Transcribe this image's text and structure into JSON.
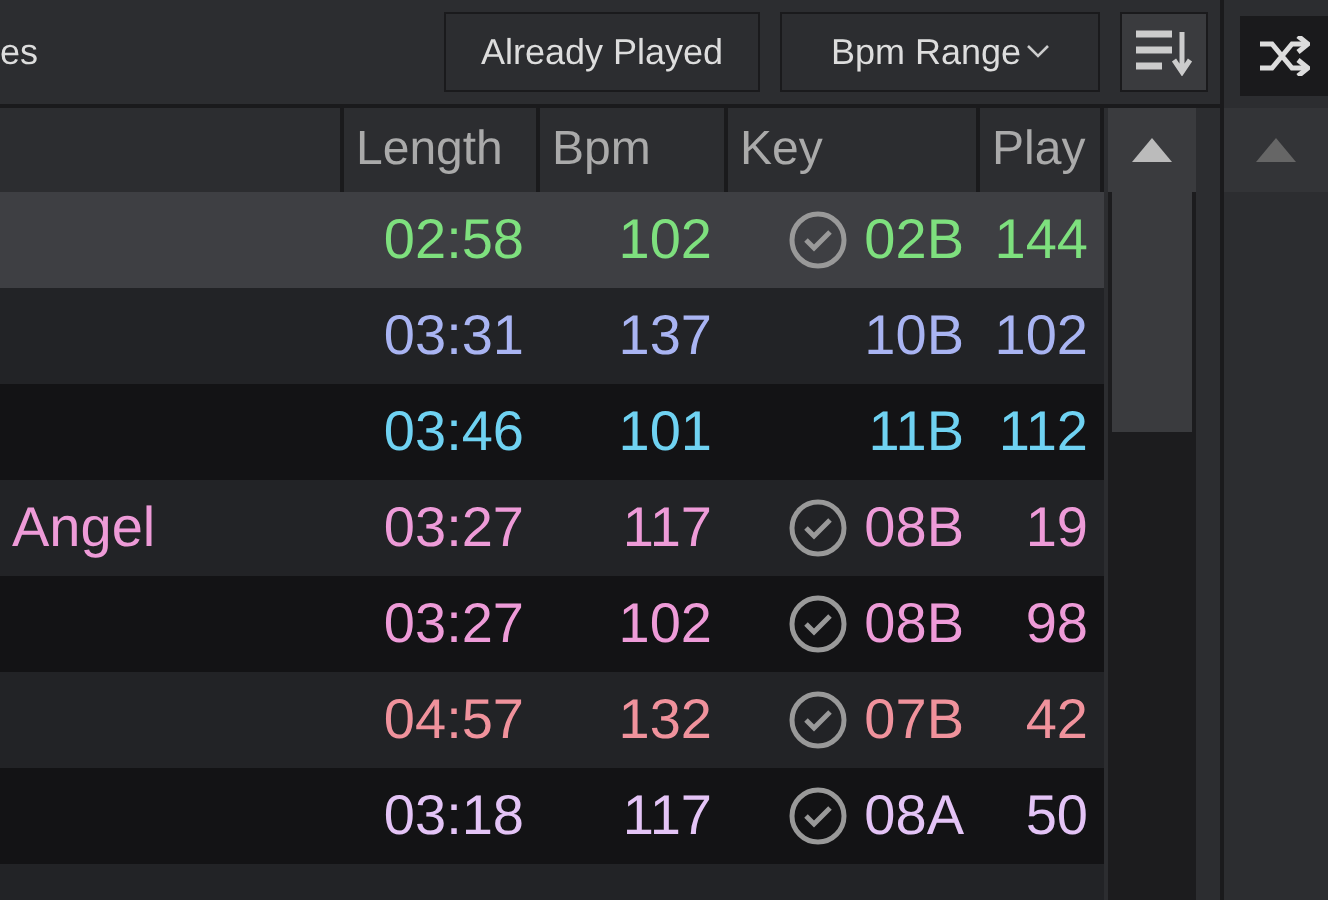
{
  "toolbar": {
    "title": "es",
    "buttons": [
      {
        "label": "Already Played",
        "kind": "plain"
      },
      {
        "label": "Bpm Range",
        "kind": "dropdown"
      }
    ]
  },
  "table": {
    "columns": [
      "Length",
      "Bpm",
      "Key",
      "Play"
    ],
    "rows": [
      {
        "title": "",
        "length": "02:58",
        "bpm": "102",
        "key": "02B",
        "plays": "144",
        "played": true,
        "selected": true,
        "color": "#7ee07e"
      },
      {
        "title": "",
        "length": "03:31",
        "bpm": "137",
        "key": "10B",
        "plays": "102",
        "played": false,
        "selected": false,
        "color": "#a9b4f2"
      },
      {
        "title": "",
        "length": "03:46",
        "bpm": "101",
        "key": "11B",
        "plays": "112",
        "played": false,
        "selected": false,
        "color": "#6fd2f2"
      },
      {
        "title": "Angel",
        "length": "03:27",
        "bpm": "117",
        "key": "08B",
        "plays": "19",
        "played": true,
        "selected": false,
        "color": "#ee9bd8"
      },
      {
        "title": "",
        "length": "03:27",
        "bpm": "102",
        "key": "08B",
        "plays": "98",
        "played": true,
        "selected": false,
        "color": "#ee9bd8"
      },
      {
        "title": "",
        "length": "04:57",
        "bpm": "132",
        "key": "07B",
        "plays": "42",
        "played": true,
        "selected": false,
        "color": "#f0929c"
      },
      {
        "title": "",
        "length": "03:18",
        "bpm": "117",
        "key": "08A",
        "plays": "50",
        "played": true,
        "selected": false,
        "color": "#e4c4f6"
      }
    ]
  }
}
